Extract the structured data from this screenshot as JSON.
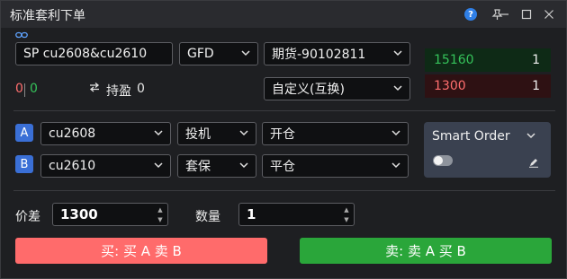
{
  "window": {
    "title": "标准套利下单"
  },
  "combo": {
    "symbol": "SP cu2608&cu2610",
    "validity": "GFD",
    "account": "期货-90102811",
    "price_mode": "自定义(互换)"
  },
  "quote": {
    "bid": {
      "price": "15160",
      "qty": "1"
    },
    "ask": {
      "price": "1300",
      "qty": "1"
    }
  },
  "position": {
    "long": "0",
    "short": "0",
    "hold_label": "持盈",
    "hold_value": "0"
  },
  "legs": [
    {
      "badge": "A",
      "contract": "cu2608",
      "hedge": "投机",
      "offset": "开仓"
    },
    {
      "badge": "B",
      "contract": "cu2610",
      "hedge": "套保",
      "offset": "平仓"
    }
  ],
  "smart_order": {
    "label": "Smart Order",
    "enabled": false
  },
  "order": {
    "spread_label": "价差",
    "spread_value": "1300",
    "qty_label": "数量",
    "qty_value": "1"
  },
  "actions": {
    "buy_label": "买: 买 A 卖 B",
    "sell_label": "卖: 卖 A 买 B"
  },
  "colors": {
    "buy": "#ff6b6b",
    "sell": "#2aa63a",
    "accent": "#3a6fd6"
  }
}
